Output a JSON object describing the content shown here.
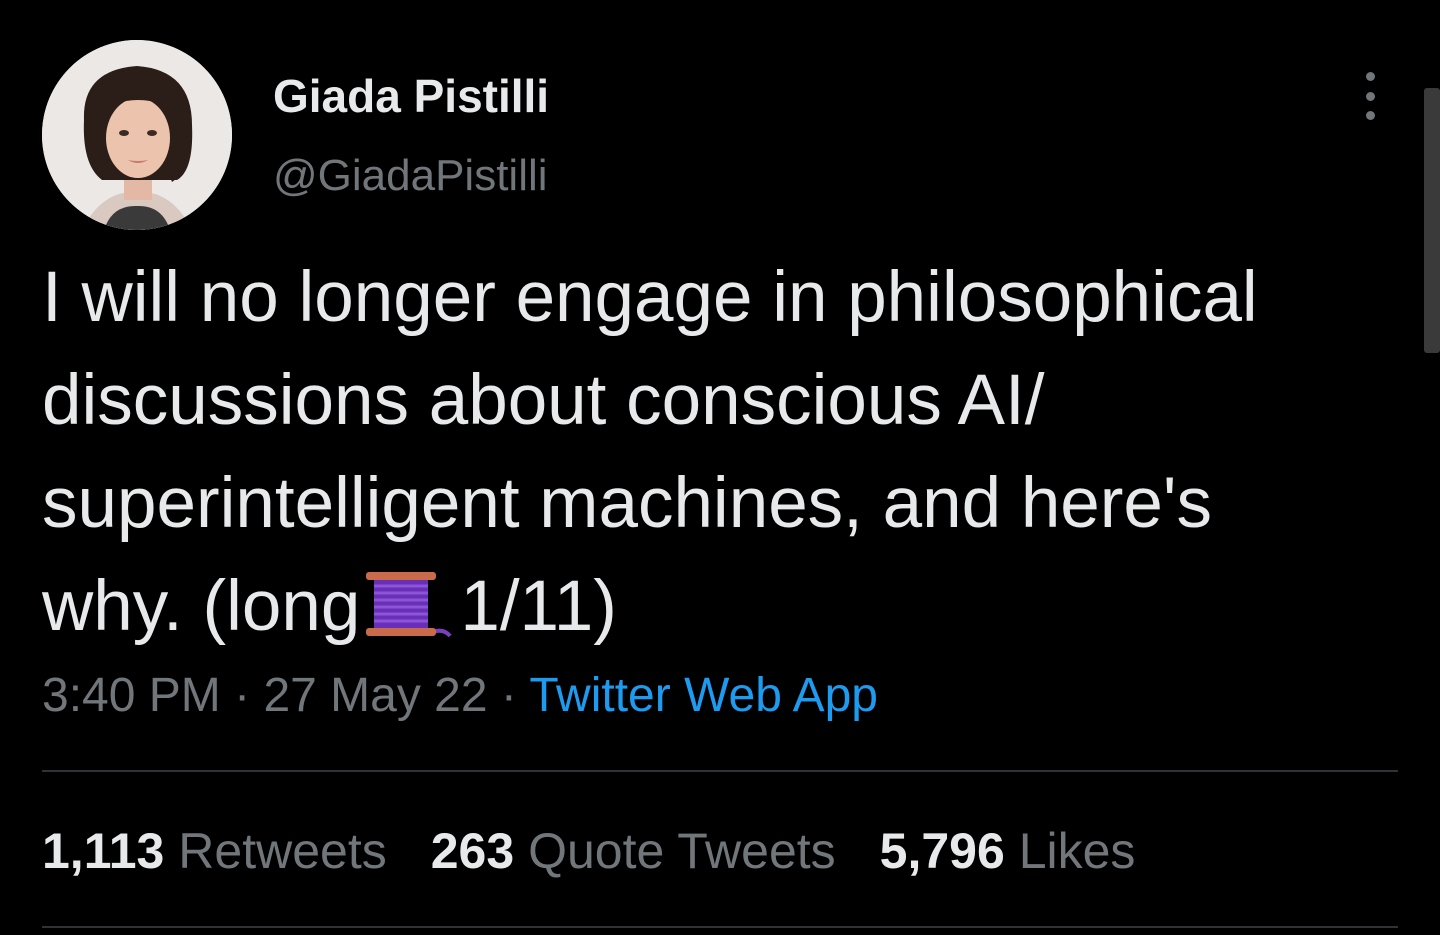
{
  "author": {
    "display_name": "Giada Pistilli",
    "handle": "@GiadaPistilli",
    "avatar_icon": "profile-photo"
  },
  "tweet": {
    "text_lines": [
      "I will no longer engage in philosophical",
      "discussions about conscious AI/",
      "superintelligent machines, and here's",
      "why. (long"
    ],
    "emoji": "thread-spool-icon",
    "text_tail": "1/11)"
  },
  "meta": {
    "time": "3:40 PM",
    "sep1": "·",
    "date": "27 May 22",
    "sep2": "·",
    "source": "Twitter Web App"
  },
  "stats": {
    "retweets_count": "1,113",
    "retweets_label": "Retweets",
    "quotes_count": "263",
    "quotes_label": "Quote Tweets",
    "likes_count": "5,796",
    "likes_label": "Likes"
  },
  "colors": {
    "background": "#000000",
    "text": "#e7e9ea",
    "secondary": "#71767b",
    "link": "#1d9bf0",
    "divider": "#2f3336"
  }
}
